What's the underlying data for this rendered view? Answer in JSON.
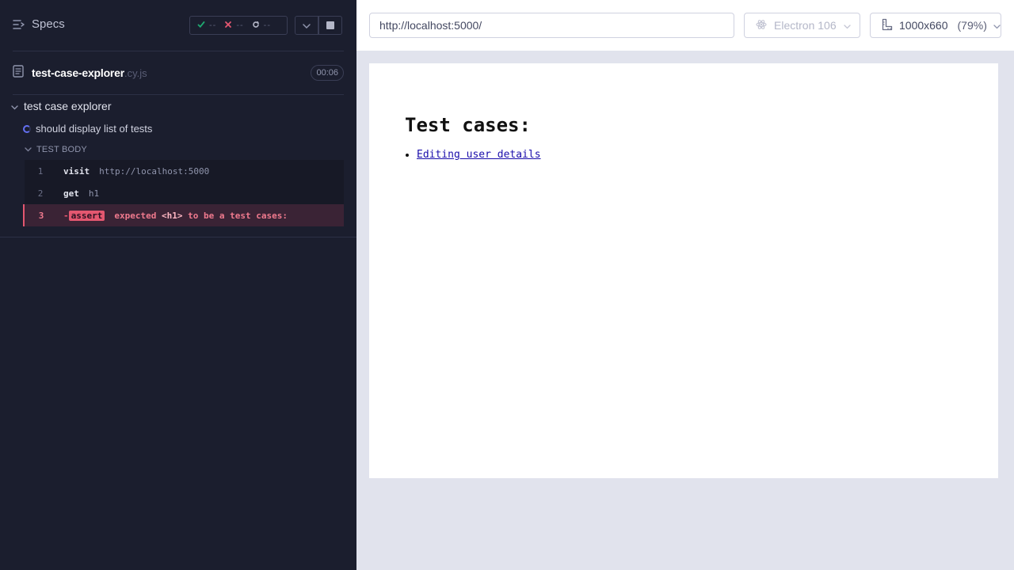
{
  "topbar": {
    "specs_label": "Specs",
    "passed": "--",
    "failed": "--",
    "pending": "--"
  },
  "spec": {
    "name": "test-case-explorer",
    "ext": ".cy.js",
    "duration": "00:06"
  },
  "suite": {
    "title": "test case explorer"
  },
  "test": {
    "title": "should display list of tests"
  },
  "test_body": {
    "label": "TEST BODY"
  },
  "commands": [
    {
      "num": "1",
      "name": "visit",
      "arg": "http://localhost:5000"
    },
    {
      "num": "2",
      "name": "get",
      "arg": "h1"
    },
    {
      "num": "3",
      "dash": "-",
      "name": "assert",
      "msg_pre": "expected ",
      "msg_el": "<h1>",
      "msg_post": " to be a test cases:"
    }
  ],
  "aut_header": {
    "url": "http://localhost:5000/",
    "browser": "Electron 106",
    "viewport": "1000x660",
    "scale": "(79%)"
  },
  "aut": {
    "heading": "Test cases:",
    "items": [
      "Editing user details"
    ]
  },
  "colors": {
    "reporter_bg": "#1b1e2e",
    "passed": "#1fa971",
    "failed": "#e45770",
    "running": "#6470f3"
  }
}
